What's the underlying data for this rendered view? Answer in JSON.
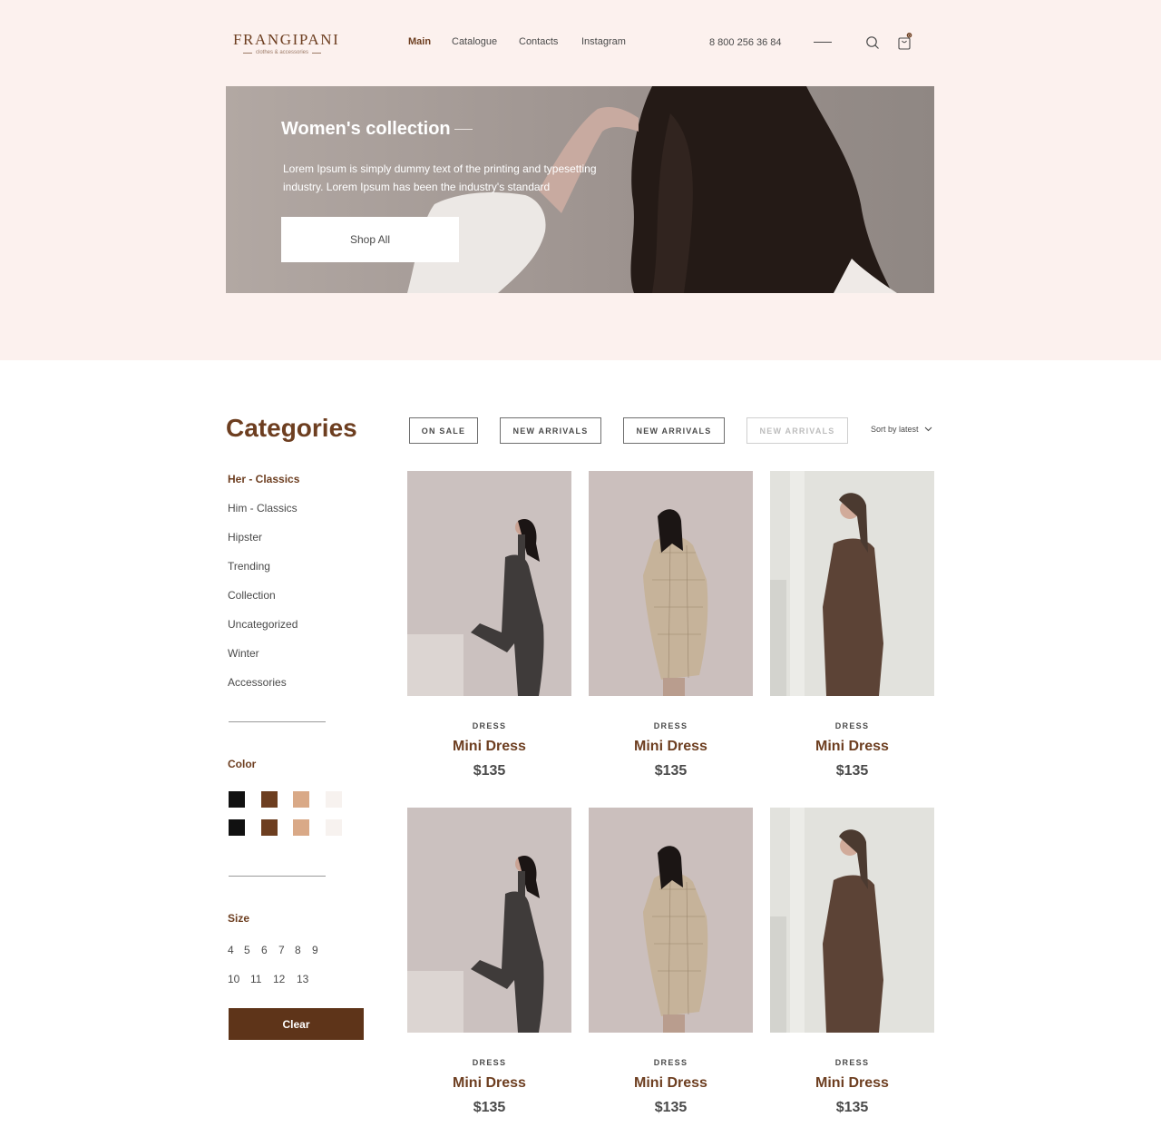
{
  "header": {
    "logo_title": "FRANGIPANI",
    "logo_subtitle": "clothes & accessories",
    "nav": [
      {
        "label": "Main",
        "active": true
      },
      {
        "label": "Catalogue",
        "active": false
      },
      {
        "label": "Contacts",
        "active": false
      },
      {
        "label": "Instagram",
        "active": false
      }
    ],
    "phone": "8 800 256 36 84",
    "cart_count": "0"
  },
  "hero": {
    "title": "Women's collection",
    "text": "Lorem Ipsum is simply dummy text of the printing and typesetting industry. Lorem Ipsum has been the industry's standard",
    "button": "Shop All"
  },
  "sidebar": {
    "title": "Categories",
    "categories": [
      {
        "label": "Her - Classics",
        "active": true
      },
      {
        "label": "Him - Classics",
        "active": false
      },
      {
        "label": "Hipster",
        "active": false
      },
      {
        "label": "Trending",
        "active": false
      },
      {
        "label": "Collection",
        "active": false
      },
      {
        "label": "Uncategorized",
        "active": false
      },
      {
        "label": "Winter",
        "active": false
      },
      {
        "label": "Accessories",
        "active": false
      }
    ],
    "color_label": "Color",
    "colors": [
      "#111111",
      "#6d3e20",
      "#d9a987",
      "#f7f2ef",
      "#111111",
      "#6d3e20",
      "#d9a987",
      "#f7f2ef"
    ],
    "size_label": "Size",
    "sizes_row1": [
      "4",
      "5",
      "6",
      "7",
      "8",
      "9"
    ],
    "sizes_row2": [
      "10",
      "11",
      "12",
      "13"
    ],
    "clear_button": "Clear"
  },
  "filters": {
    "tabs": [
      {
        "label": "ON SALE",
        "disabled": false
      },
      {
        "label": "NEW ARRIVALS",
        "disabled": false
      },
      {
        "label": "NEW ARRIVALS",
        "disabled": false
      },
      {
        "label": "NEW ARRIVALS",
        "disabled": true
      }
    ],
    "sort_label": "Sort by latest"
  },
  "products": [
    {
      "category": "DRESS",
      "name": "Mini Dress",
      "price": "$135"
    },
    {
      "category": "DRESS",
      "name": "Mini Dress",
      "price": "$135"
    },
    {
      "category": "DRESS",
      "name": "Mini Dress",
      "price": "$135"
    },
    {
      "category": "DRESS",
      "name": "Mini Dress",
      "price": "$135"
    },
    {
      "category": "DRESS",
      "name": "Mini Dress",
      "price": "$135"
    },
    {
      "category": "DRESS",
      "name": "Mini Dress",
      "price": "$135"
    }
  ]
}
